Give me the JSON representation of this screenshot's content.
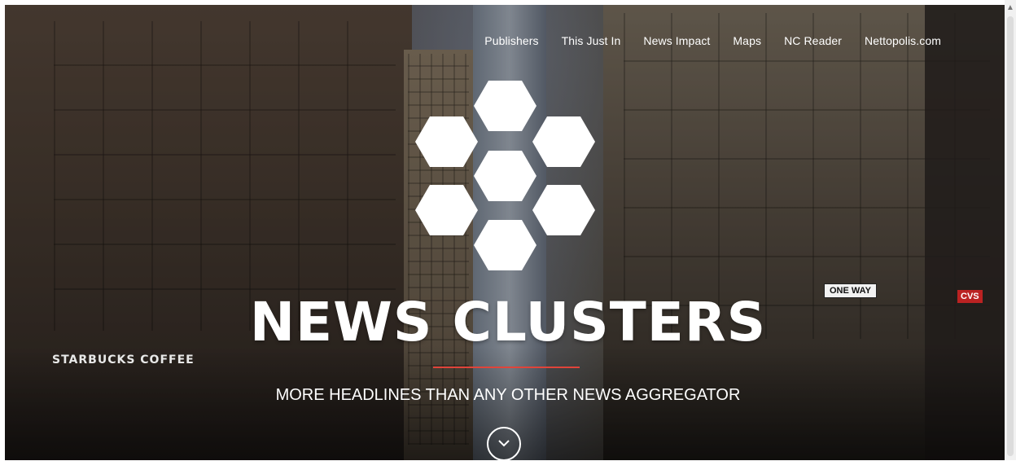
{
  "nav": {
    "items": [
      {
        "label": "Publishers"
      },
      {
        "label": "This Just In"
      },
      {
        "label": "News Impact"
      },
      {
        "label": "Maps"
      },
      {
        "label": "NC Reader"
      },
      {
        "label": "Nettopolis.com"
      }
    ]
  },
  "hero": {
    "title": "NEWS CLUSTERS",
    "tagline": "MORE HEADLINES THAN ANY OTHER NEWS AGGREGATOR",
    "accent_color": "#e0443a",
    "logo_icon": "hexagon-cluster-icon",
    "scroll_icon": "chevron-down-icon"
  },
  "background_signs": {
    "starbucks": "STARBUCKS COFFEE",
    "one_way": "ONE WAY",
    "cvs": "CVS"
  }
}
